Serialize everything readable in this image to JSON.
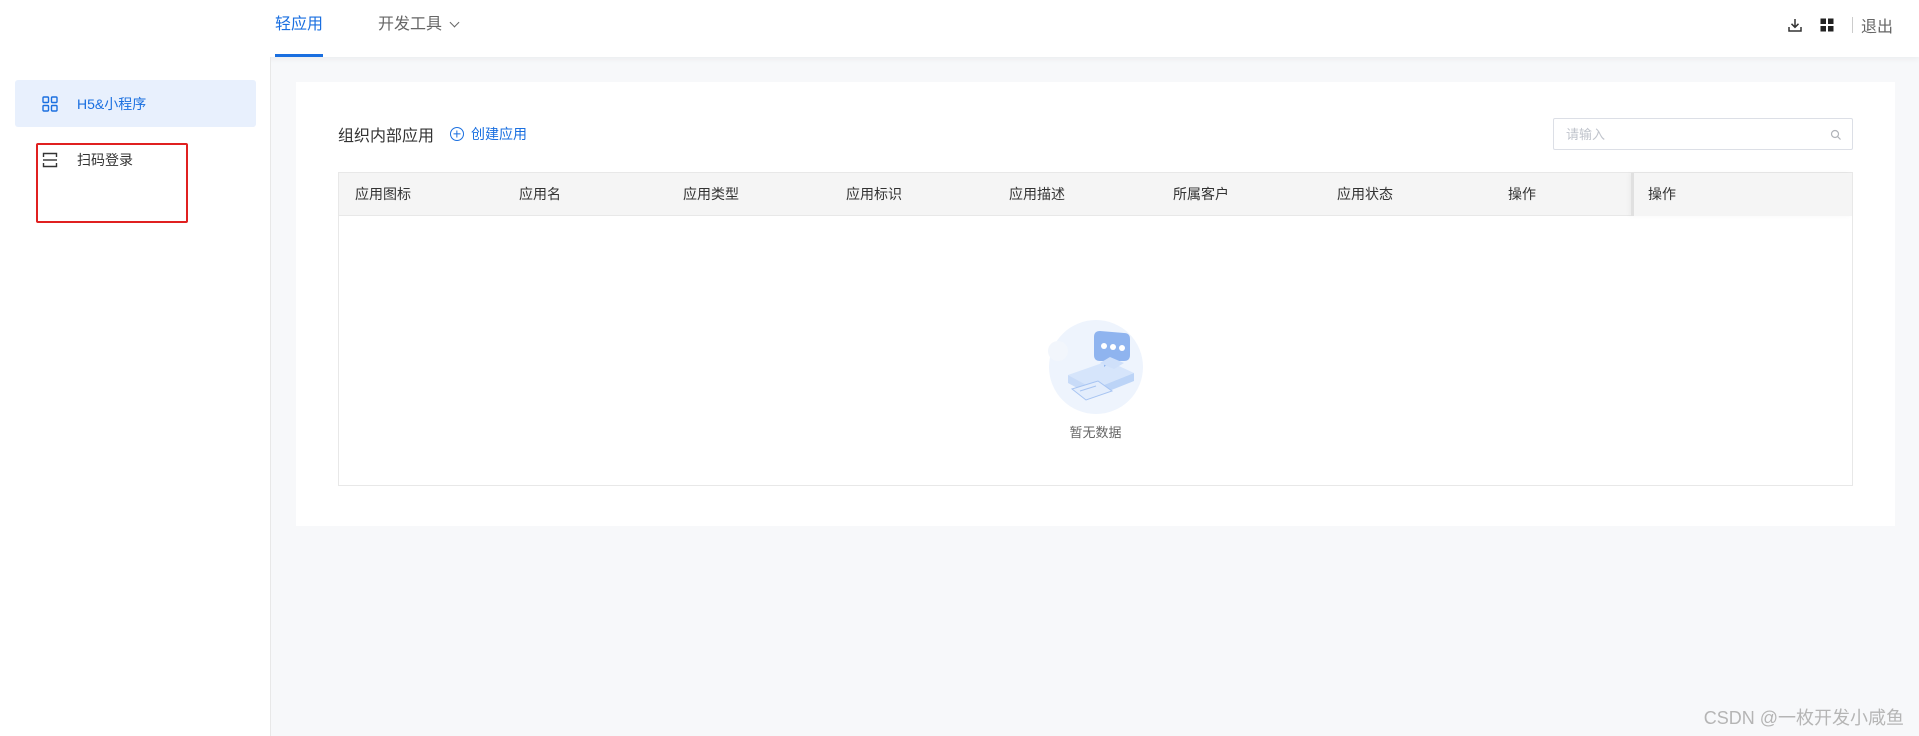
{
  "header": {
    "tabs": [
      {
        "label": "轻应用",
        "active": true
      },
      {
        "label": "开发工具",
        "active": false
      }
    ],
    "logout_label": "退出",
    "icons": [
      "download-icon",
      "grid-icon"
    ]
  },
  "sidebar": {
    "items": [
      {
        "label": "H5&小程序",
        "icon": "apps-grid-icon",
        "active": true
      },
      {
        "label": "扫码登录",
        "icon": "scan-icon",
        "active": false
      }
    ]
  },
  "main": {
    "title": "组织内部应用",
    "create_label": "创建应用",
    "search_placeholder": "请输入",
    "columns": [
      "应用图标",
      "应用名",
      "应用类型",
      "应用标识",
      "应用描述",
      "所属客户",
      "应用状态",
      "操作"
    ],
    "fixed_column": "操作",
    "empty_text": "暂无数据"
  },
  "watermark": "CSDN @一枚开发小咸鱼",
  "colors": {
    "accent": "#1a6fe0",
    "highlight": "#e02020",
    "active_bg": "#e8f0fd"
  }
}
